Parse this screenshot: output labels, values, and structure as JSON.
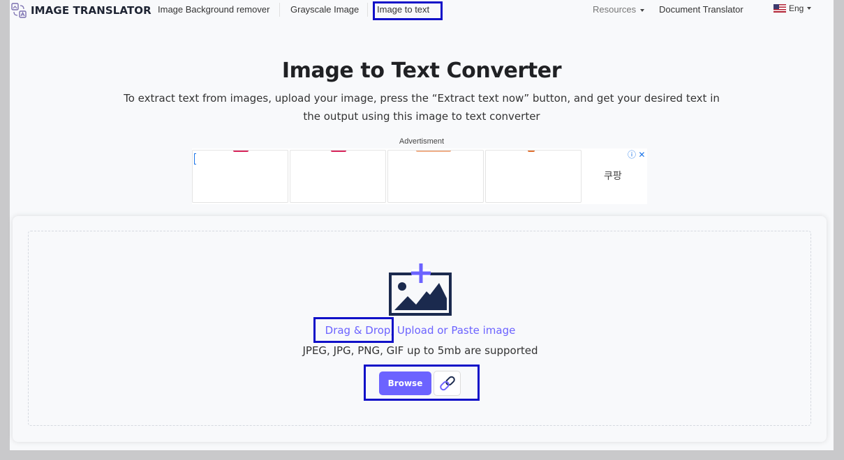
{
  "nav": {
    "logo_text": "IMAGE TRANSLATOR",
    "links": [
      "Image Background remover",
      "Grayscale Image",
      "Image to text"
    ],
    "resources_label": "Resources",
    "document_translator_label": "Document Translator",
    "language_label": "Eng",
    "active_link": "Image to text"
  },
  "hero": {
    "title": "Image to Text Converter",
    "subtitle": "To extract text from images, upload your image, press the “Extract text now” button, and get your desired text in the output using this image to text converter"
  },
  "ad": {
    "label": "Advertisment",
    "brand": "쿠팡",
    "icons": "ⓘ ✕"
  },
  "upload": {
    "drop_text": "Drag & Drop, Upload or Paste image",
    "supported_text": "JPEG, JPG, PNG, GIF up to 5mb are supported",
    "browse_label": "Browse",
    "icon": "add-image-icon",
    "link_icon": "link-icon"
  },
  "colors": {
    "accent": "#6c63ff",
    "highlight": "#1010c8",
    "icon_dark": "#1b2a4e"
  }
}
